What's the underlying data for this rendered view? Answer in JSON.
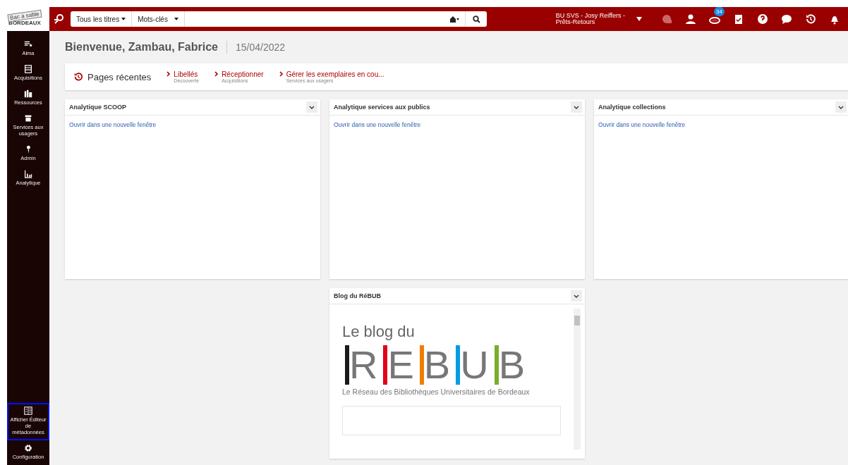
{
  "logo": {
    "badge": "Bac à sable",
    "name": "BORDEAUX"
  },
  "search": {
    "scope": "Tous les titres",
    "field": "Mots-clés"
  },
  "user": {
    "name": "BU SVS - Josy Reiffers -",
    "role": "Prêts-Retours"
  },
  "toolbar": [
    {
      "kind": "faded"
    },
    {
      "kind": "user"
    },
    {
      "kind": "bowl",
      "badge": "34"
    },
    {
      "kind": "clipboard"
    },
    {
      "kind": "help"
    },
    {
      "kind": "chat"
    },
    {
      "kind": "history"
    },
    {
      "kind": "bell"
    }
  ],
  "sidebar": {
    "items": [
      {
        "kind": "alma",
        "label": "Alma",
        "outlined": false
      },
      {
        "kind": "acq",
        "label": "Acquisitions",
        "outlined": false
      },
      {
        "kind": "res",
        "label": "Ressources",
        "outlined": false
      },
      {
        "kind": "serv",
        "label": "Services aux usagers",
        "outlined": false
      },
      {
        "kind": "admin",
        "label": "Admin",
        "outlined": false
      },
      {
        "kind": "analytics",
        "label": "Analytique",
        "outlined": false
      }
    ],
    "bottom": [
      {
        "kind": "editor",
        "label": "Afficher Éditeur de métadonnées",
        "outlined": true
      },
      {
        "kind": "gear",
        "label": "Configuration",
        "outlined": false
      }
    ]
  },
  "welcome": {
    "title": "Bienvenue, Zambau, Fabrice",
    "date": "15/04/2022"
  },
  "recent": {
    "title": "Pages récentes",
    "links": [
      {
        "label": "Libellés",
        "area": "Découverte"
      },
      {
        "label": "Réceptionner",
        "area": "Acquisitions"
      },
      {
        "label": "Gérer les exemplaires en cou...",
        "area": "Services aux usagers"
      }
    ]
  },
  "widgets": [
    {
      "title": "Analytique SCOOP",
      "link": "Ouvrir dans une nouvelle fenêtre"
    },
    {
      "title": "Analytique services aux publics",
      "link": "Ouvrir dans une nouvelle fenêtre"
    },
    {
      "title": "Analytique collections",
      "link": "Ouvrir dans une nouvelle fenêtre"
    }
  ],
  "blog": {
    "title": "Blog du RéBUB",
    "heading": "Le blog du",
    "letters": [
      {
        "letter": "R",
        "color": "#1a1a1a"
      },
      {
        "letter": "E",
        "color": "#e3001b"
      },
      {
        "letter": "B",
        "color": "#f07d00"
      },
      {
        "letter": "U",
        "color": "#009ee0"
      },
      {
        "letter": "B",
        "color": "#7aad2c"
      }
    ],
    "subtitle": "Le Réseau des Bibliothèques Universitaires de Bordeaux"
  }
}
